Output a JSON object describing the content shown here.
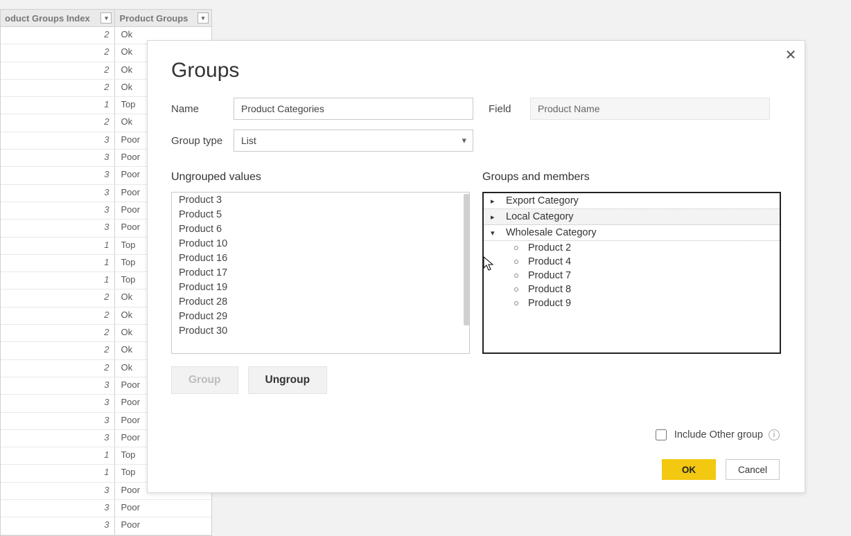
{
  "table": {
    "headers": {
      "idx": "oduct Groups Index",
      "grp": "Product Groups"
    },
    "rows": [
      {
        "idx": "2",
        "grp": "Ok"
      },
      {
        "idx": "2",
        "grp": "Ok"
      },
      {
        "idx": "2",
        "grp": "Ok"
      },
      {
        "idx": "2",
        "grp": "Ok"
      },
      {
        "idx": "1",
        "grp": "Top"
      },
      {
        "idx": "2",
        "grp": "Ok"
      },
      {
        "idx": "3",
        "grp": "Poor"
      },
      {
        "idx": "3",
        "grp": "Poor"
      },
      {
        "idx": "3",
        "grp": "Poor"
      },
      {
        "idx": "3",
        "grp": "Poor"
      },
      {
        "idx": "3",
        "grp": "Poor"
      },
      {
        "idx": "3",
        "grp": "Poor"
      },
      {
        "idx": "1",
        "grp": "Top"
      },
      {
        "idx": "1",
        "grp": "Top"
      },
      {
        "idx": "1",
        "grp": "Top"
      },
      {
        "idx": "2",
        "grp": "Ok"
      },
      {
        "idx": "2",
        "grp": "Ok"
      },
      {
        "idx": "2",
        "grp": "Ok"
      },
      {
        "idx": "2",
        "grp": "Ok"
      },
      {
        "idx": "2",
        "grp": "Ok"
      },
      {
        "idx": "3",
        "grp": "Poor"
      },
      {
        "idx": "3",
        "grp": "Poor"
      },
      {
        "idx": "3",
        "grp": "Poor"
      },
      {
        "idx": "3",
        "grp": "Poor"
      },
      {
        "idx": "1",
        "grp": "Top"
      },
      {
        "idx": "1",
        "grp": "Top"
      },
      {
        "idx": "3",
        "grp": "Poor"
      },
      {
        "idx": "3",
        "grp": "Poor"
      },
      {
        "idx": "3",
        "grp": "Poor"
      }
    ]
  },
  "dialog": {
    "title": "Groups",
    "labels": {
      "name": "Name",
      "field": "Field",
      "group_type": "Group type",
      "ungrouped": "Ungrouped values",
      "groups_members": "Groups and members",
      "include_other": "Include Other group"
    },
    "name_value": "Product Categories",
    "field_value": "Product Name",
    "group_type_value": "List",
    "ungrouped": [
      "Product 3",
      "Product 5",
      "Product 6",
      "Product 10",
      "Product 16",
      "Product 17",
      "Product 19",
      "Product 28",
      "Product 29",
      "Product 30"
    ],
    "groups": [
      {
        "name": "Export Category",
        "expanded": false,
        "members": []
      },
      {
        "name": "Local Category",
        "expanded": false,
        "members": []
      },
      {
        "name": "Wholesale Category",
        "expanded": true,
        "members": [
          "Product 2",
          "Product 4",
          "Product 7",
          "Product 8",
          "Product 9"
        ]
      }
    ],
    "buttons": {
      "group": "Group",
      "ungroup": "Ungroup",
      "ok": "OK",
      "cancel": "Cancel"
    }
  }
}
